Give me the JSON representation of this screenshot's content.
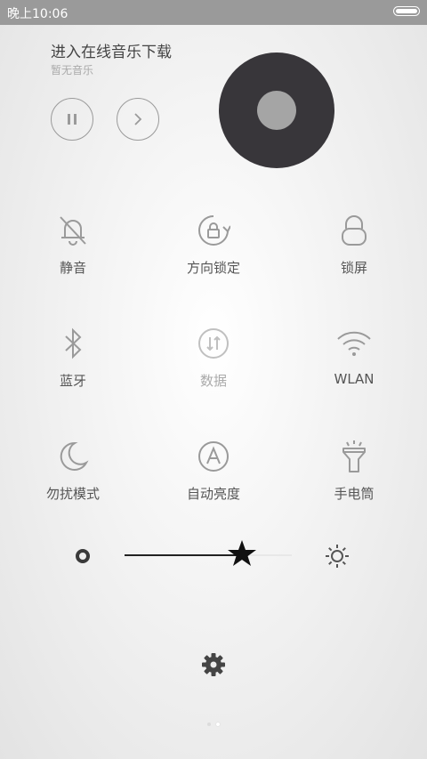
{
  "status_bar": {
    "time": "晚上10:06"
  },
  "music": {
    "title": "进入在线音乐下载",
    "subtitle": "暂无音乐"
  },
  "toggles": [
    {
      "label": "静音",
      "icon": "bell-off-icon"
    },
    {
      "label": "方向锁定",
      "icon": "rotation-lock-icon"
    },
    {
      "label": "锁屏",
      "icon": "lock-icon"
    },
    {
      "label": "蓝牙",
      "icon": "bluetooth-icon"
    },
    {
      "label": "数据",
      "icon": "mobile-data-icon",
      "disabled": true
    },
    {
      "label": "WLAN",
      "icon": "wifi-icon"
    },
    {
      "label": "勿扰模式",
      "icon": "moon-icon"
    },
    {
      "label": "自动亮度",
      "icon": "auto-brightness-icon"
    },
    {
      "label": "手电筒",
      "icon": "flashlight-icon"
    }
  ],
  "brightness": {
    "level": 0.7
  },
  "pager": {
    "pages": 2,
    "active": 1
  },
  "colors": {
    "disc": "#38363a",
    "status_bar": "#9a9a9a",
    "icon": "#9a9a9a"
  }
}
